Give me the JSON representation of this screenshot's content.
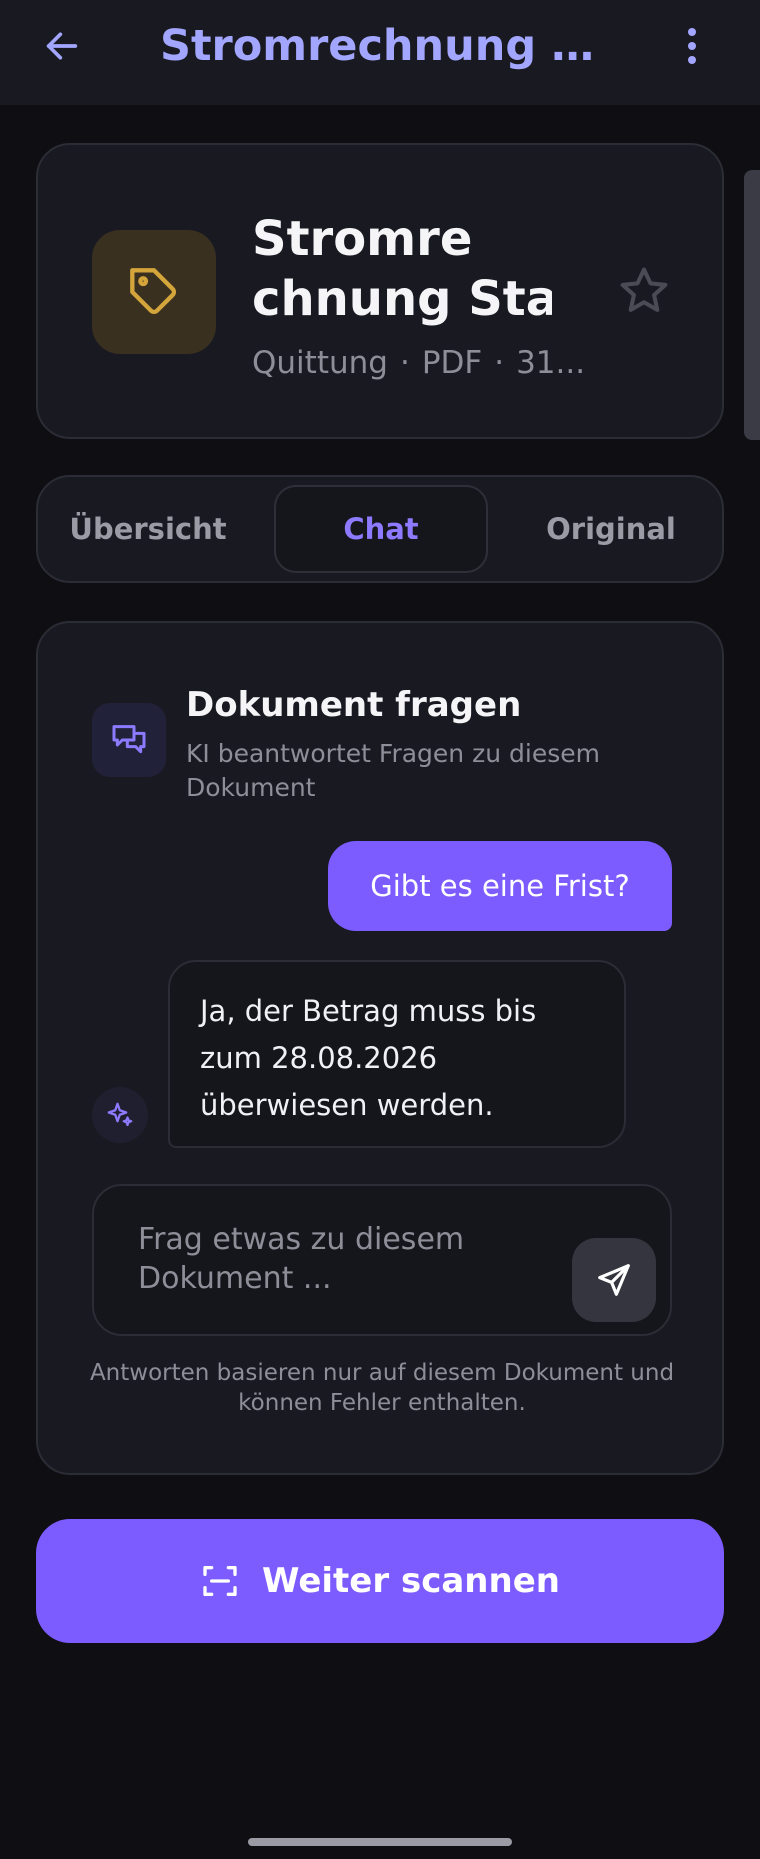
{
  "appbar": {
    "title": "Stromrechnung Stadt..."
  },
  "document": {
    "title_line1": "Stromre",
    "title_line2": "chnung Sta...",
    "meta_type": "Quittung",
    "meta_sep": "·",
    "meta_format": "PDF",
    "meta_size": "31...",
    "icon": "tag-icon",
    "accent_color": "#d4a53a"
  },
  "tabs": [
    {
      "label": "Übersicht",
      "active": false
    },
    {
      "label": "Chat",
      "active": true
    },
    {
      "label": "Original",
      "active": false
    }
  ],
  "chat": {
    "title": "Dokument fragen",
    "subtitle": "KI beantwortet Fragen zu diesem Dokument",
    "messages": [
      {
        "role": "user",
        "text": "Gibt es eine Frist?"
      },
      {
        "role": "ai",
        "text": "Ja, der Betrag muss bis zum 28.08.2026 überwiesen werden."
      }
    ],
    "input_placeholder": "Frag etwas zu diesem Dokument ...",
    "disclaimer": "Antworten basieren nur auf diesem Dokument und können Fehler enthalten."
  },
  "actions": {
    "scan_label": "Weiter scannen"
  },
  "colors": {
    "primary": "#7c5cff",
    "title_accent": "#a3a6ff",
    "background": "#0e0e13",
    "card": "#191a21"
  }
}
